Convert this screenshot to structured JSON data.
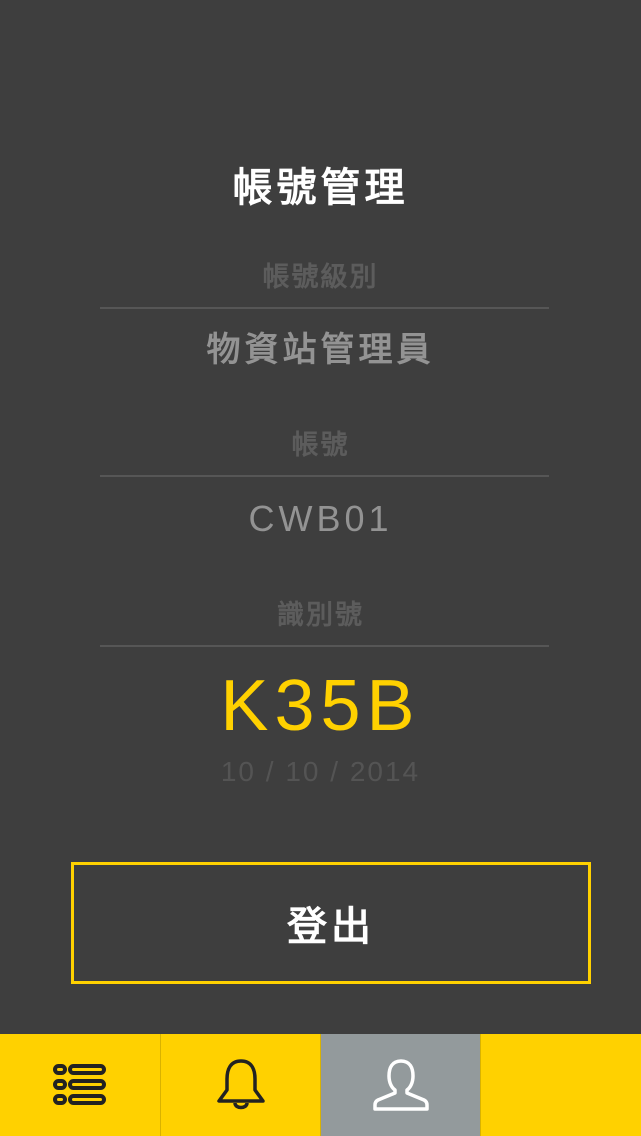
{
  "header": {
    "title": "帳號管理"
  },
  "account": {
    "level_label": "帳號級別",
    "level_value": "物資站管理員",
    "account_label": "帳號",
    "account_value": "CWB01",
    "id_label": "識別號",
    "id_value": "K35B",
    "date": "10 / 10 / 2014"
  },
  "actions": {
    "logout_label": "登出"
  },
  "tab_bar": {
    "tabs": [
      {
        "icon": "list-icon",
        "active": false
      },
      {
        "icon": "bell-icon",
        "active": false
      },
      {
        "icon": "user-icon",
        "active": true
      },
      {
        "icon": "",
        "active": false
      }
    ]
  },
  "colors": {
    "background": "#3e3e3e",
    "accent": "#ffd100",
    "active_tab": "#939a9c"
  }
}
